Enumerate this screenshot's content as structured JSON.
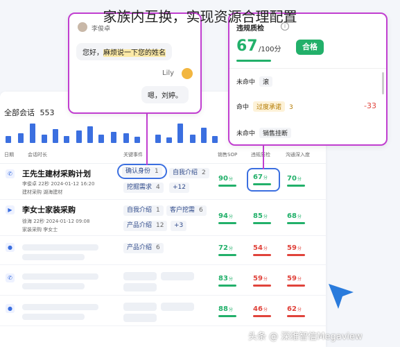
{
  "title": "家族内互换，实现资源合理配置",
  "conversations": {
    "label": "全部会话",
    "count": "553"
  },
  "columns": {
    "date": "日期",
    "duration": "会话时长",
    "key_events": "关键事件",
    "sop": "销售SOP",
    "violation": "违规质检",
    "depth": "沟通深入度"
  },
  "rows": [
    {
      "title": "王先生建材采购计划",
      "meta1": "李俊卓  22秒  2024-01-12 16:20",
      "meta2": "建材采购    湖海建材",
      "tags": [
        {
          "label": "确认身份",
          "n": "1"
        },
        {
          "label": "自我介绍",
          "n": "2"
        },
        {
          "label": "挖掘需求",
          "n": "4"
        },
        {
          "label": "+12",
          "n": ""
        }
      ],
      "sop": "90",
      "violation": "67",
      "depth": "70"
    },
    {
      "title": "李女士家装采购",
      "meta1": "徐海  22秒  2024-01-12 09:08",
      "meta2": "家装采购    李女士",
      "tags": [
        {
          "label": "自我介绍",
          "n": "1"
        },
        {
          "label": "客户挖需",
          "n": "6"
        },
        {
          "label": "产品介绍",
          "n": "12"
        },
        {
          "label": "+3",
          "n": ""
        }
      ],
      "sop": "94",
      "violation": "85",
      "depth": "68"
    },
    {
      "tags": [
        {
          "label": "产品介绍",
          "n": "6"
        }
      ],
      "sop": "72",
      "violation": "54",
      "depth": "59"
    },
    {
      "sop": "83",
      "violation": "59",
      "depth": "59"
    },
    {
      "sop": "88",
      "violation": "46",
      "depth": "62"
    }
  ],
  "score_unit": "分",
  "chat": {
    "name": "李俊卓",
    "msg1_pre": "您好，",
    "msg1_hl": "麻烦说一下您的姓名",
    "user": "Lily",
    "msg2": "嗯，刘婷。"
  },
  "quality": {
    "title": "违规质检",
    "score": "67",
    "total": "/100分",
    "status": "合格",
    "items": [
      {
        "label": "未命中",
        "tag": "滚",
        "value": ""
      },
      {
        "label": "命中",
        "tag": "过度承诺",
        "n": "3",
        "value": "-33"
      },
      {
        "label": "未命中",
        "tag": "销售挂断",
        "value": ""
      }
    ]
  },
  "watermark": "头条 @ 深维智信Megaview",
  "colors": {
    "accent": "#3b6fe0",
    "green": "#22b06a",
    "red": "#e0433b",
    "purple": "#c13ed0"
  }
}
